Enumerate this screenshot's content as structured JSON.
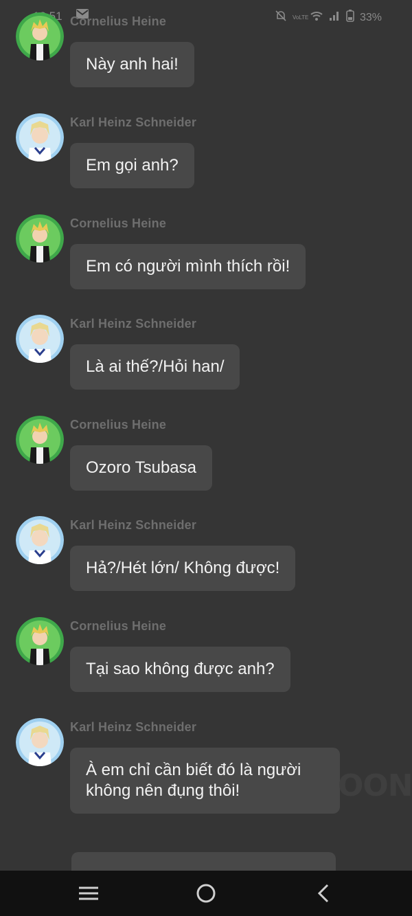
{
  "status_bar": {
    "time": "18:51",
    "battery": "33%",
    "volte_label": "VoLTE",
    "icons": [
      "mail-icon",
      "bell-off-icon",
      "wifi-icon",
      "signal-icon",
      "battery-icon"
    ]
  },
  "participants": {
    "cornelius": {
      "name": "Cornelius Heine",
      "avatar_icon": "cornelius-avatar"
    },
    "karl": {
      "name": "Karl Heinz Schneider",
      "avatar_icon": "karl-avatar"
    }
  },
  "messages": [
    {
      "sender": "Cornelius Heine",
      "text": "Này anh hai!"
    },
    {
      "sender": "Karl Heinz Schneider",
      "text": "Em gọi anh?"
    },
    {
      "sender": "Cornelius Heine",
      "text": "Em có người mình thích rồi!"
    },
    {
      "sender": "Karl Heinz Schneider",
      "text": "Là ai thế?/Hỏi han/"
    },
    {
      "sender": "Cornelius Heine",
      "text": "Ozoro Tsubasa"
    },
    {
      "sender": "Karl Heinz Schneider",
      "text": "Hả?/Hét lớn/ Không được!"
    },
    {
      "sender": "Cornelius Heine",
      "text": "Tại sao không được anh?"
    },
    {
      "sender": "Karl Heinz Schneider",
      "text_line1": "À em chỉ cần biết đó là người",
      "text_line2": "không nên đụng thôi!"
    }
  ],
  "watermark": "OON",
  "nav_bar": {
    "icons": [
      "menu-icon",
      "home-icon",
      "back-icon"
    ]
  },
  "colors": {
    "background": "#353535",
    "bubble": "#484848",
    "sender_text": "#6e6e6e",
    "message_text": "#f2f2f2",
    "nav_background": "#111111"
  }
}
